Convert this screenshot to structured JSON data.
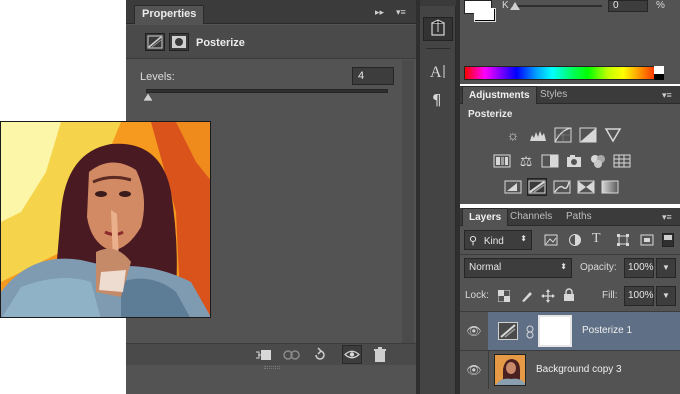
{
  "properties": {
    "tab_label": "Properties",
    "collapse_glyph": "▸▸",
    "menu_glyph": "▾≡",
    "title": "Posterize",
    "levels_label": "Levels:",
    "levels_value": "4",
    "levels_slider_fraction": 0.0
  },
  "color_panel": {
    "channel_label": "K",
    "value": "0",
    "unit": "%"
  },
  "adjustments": {
    "tabs": [
      "Adjustments",
      "Styles"
    ],
    "active_tab": "Adjustments",
    "current": "Posterize",
    "icons_row1": [
      "brightness-contrast-icon",
      "levels-icon",
      "curves-icon",
      "exposure-icon",
      "vibrance-icon"
    ],
    "icons_row2": [
      "hue-saturation-icon",
      "color-balance-icon",
      "black-white-icon",
      "photo-filter-icon",
      "channel-mixer-icon",
      "color-lookup-icon"
    ],
    "icons_row3": [
      "invert-icon",
      "posterize-icon",
      "threshold-icon",
      "selective-color-icon",
      "gradient-map-icon"
    ]
  },
  "layers": {
    "tabs": [
      "Layers",
      "Channels",
      "Paths"
    ],
    "active_tab": "Layers",
    "filter_label": "Kind",
    "blend_mode": "Normal",
    "opacity_label": "Opacity:",
    "opacity_value": "100%",
    "lock_label": "Lock:",
    "fill_label": "Fill:",
    "fill_value": "100%",
    "items": [
      {
        "name": "Posterize 1",
        "selected": true
      },
      {
        "name": "Background copy 3",
        "selected": false
      }
    ]
  },
  "colors": {
    "panel_bg": "#535353",
    "selected_row": "#5f6f86"
  }
}
